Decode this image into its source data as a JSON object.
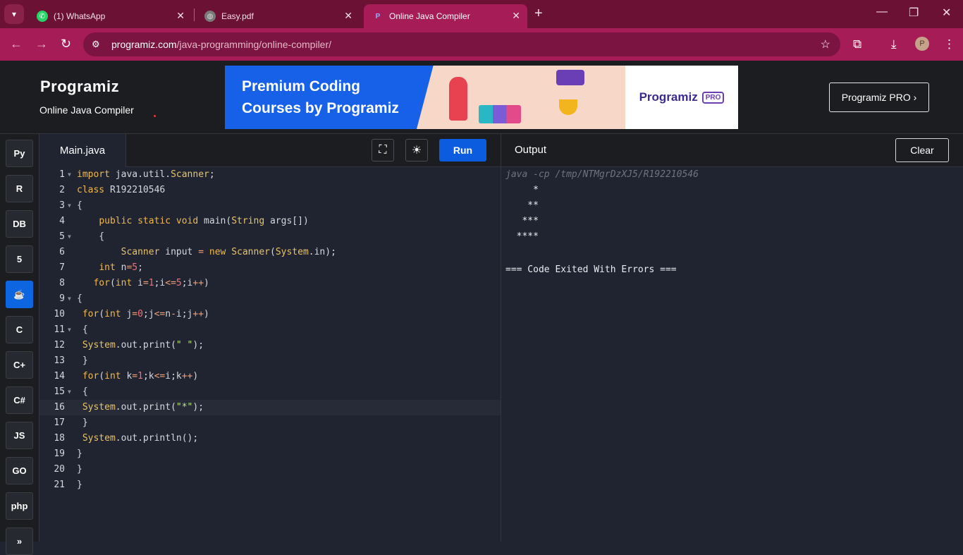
{
  "browser": {
    "tabs": [
      {
        "title": "(1) WhatsApp",
        "icon": "whatsapp-icon"
      },
      {
        "title": "Easy.pdf",
        "icon": "globe-icon"
      },
      {
        "title": "Online Java Compiler",
        "icon": "programiz-icon"
      }
    ],
    "url_host": "programiz.com",
    "url_path": "/java-programming/online-compiler/",
    "profile_initial": "P"
  },
  "header": {
    "logo": "Programiz",
    "subtitle": "Online Java Compiler",
    "banner_line1": "Premium Coding",
    "banner_line2": "Courses by Programiz",
    "banner_brand": "Programiz",
    "banner_badge": "PRO",
    "pro_button": "Programiz PRO ›"
  },
  "sidebar": {
    "languages": [
      {
        "name": "python-icon",
        "label": "Py"
      },
      {
        "name": "r-icon",
        "label": "R"
      },
      {
        "name": "sql-icon",
        "label": "DB"
      },
      {
        "name": "html-icon",
        "label": "5"
      },
      {
        "name": "java-icon",
        "label": "☕",
        "active": true
      },
      {
        "name": "c-icon",
        "label": "C"
      },
      {
        "name": "cpp-icon",
        "label": "C+"
      },
      {
        "name": "csharp-icon",
        "label": "C#"
      },
      {
        "name": "js-icon",
        "label": "JS"
      },
      {
        "name": "go-icon",
        "label": "GO"
      },
      {
        "name": "php-icon",
        "label": "php"
      },
      {
        "name": "swift-icon",
        "label": "»"
      }
    ]
  },
  "editor": {
    "file_name": "Main.java",
    "run_label": "Run",
    "highlighted_line": 16,
    "lines": [
      "import java.util.Scanner;",
      "class R192210546",
      "{",
      "    public static void main(String args[])",
      "    {",
      "        Scanner input = new Scanner(System.in);",
      "    int n=5;",
      "   for(int i=1;i<=5;i++)",
      "{",
      " for(int j=0;j<=n-i;j++)",
      " {",
      " System.out.print(\" \");",
      " }",
      " for(int k=1;k<=i;k++)",
      " {",
      " System.out.print(\"*\");",
      " }",
      " System.out.println();",
      "}",
      "}",
      "}"
    ]
  },
  "output": {
    "title": "Output",
    "clear_label": "Clear",
    "command": "java -cp /tmp/NTMgrDzXJ5/R192210546",
    "lines": [
      "     *",
      "    **",
      "   ***",
      "  ****",
      "",
      "=== Code Exited With Errors ==="
    ]
  }
}
